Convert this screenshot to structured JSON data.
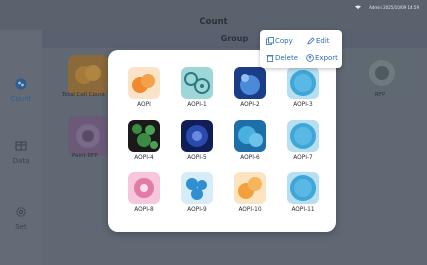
{
  "app": {
    "title": "Count",
    "status_text": "Admin  2025/10/09 14:59"
  },
  "sidebar": {
    "items": [
      {
        "label": "Count",
        "icon": "count-icon",
        "active": true
      },
      {
        "label": "Data",
        "icon": "data-icon",
        "active": false
      },
      {
        "label": "Set",
        "icon": "settings-icon",
        "active": false
      }
    ]
  },
  "background": {
    "header": "Group",
    "cards": [
      {
        "label": "Total Cell Count"
      },
      {
        "label": "Paint RFP"
      },
      {
        "label": "RFP"
      }
    ]
  },
  "menu": {
    "copy": "Copy",
    "edit": "Edit",
    "delete": "Delete",
    "export": "Export"
  },
  "grid": {
    "items": [
      {
        "label": "AOPI",
        "color": "#f08a2e"
      },
      {
        "label": "AOPI-1",
        "color": "#4bb2c2"
      },
      {
        "label": "AOPI-2",
        "color": "#2a5fb0"
      },
      {
        "label": "AOPI-3",
        "color": "#3fa6d8"
      },
      {
        "label": "AOPI-4",
        "color": "#2f6f3a"
      },
      {
        "label": "AOPI-5",
        "color": "#243f9a"
      },
      {
        "label": "AOPI-6",
        "color": "#3aa0d4"
      },
      {
        "label": "AOPI-7",
        "color": "#3fa6d8"
      },
      {
        "label": "AOPI-8",
        "color": "#e07aa8"
      },
      {
        "label": "AOPI-9",
        "color": "#2f8fd0"
      },
      {
        "label": "AOPI-10",
        "color": "#f3a03c"
      },
      {
        "label": "AOPI-11",
        "color": "#3fa6d8"
      }
    ]
  },
  "colors": {
    "accent": "#2d6fb4",
    "dialog_bg": "#ffffff",
    "overlay": "#5c6470"
  }
}
